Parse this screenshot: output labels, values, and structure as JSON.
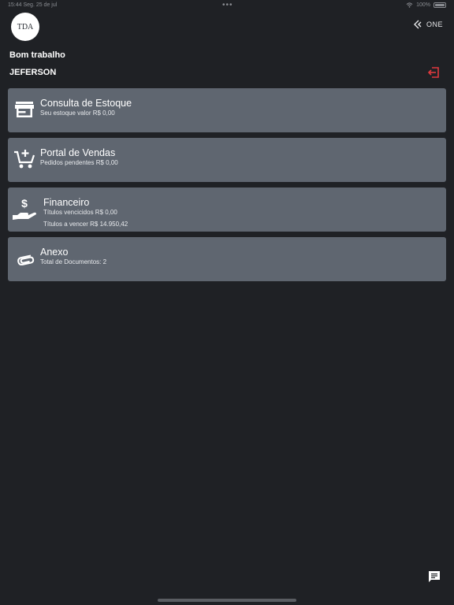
{
  "status_bar": {
    "time": "15:44",
    "date": "Seg. 25 de jul",
    "battery": "100%"
  },
  "header": {
    "logo_text": "TDA",
    "brand_text": "ONE",
    "greeting": "Bom trabalho",
    "username": "JEFERSON"
  },
  "cards": [
    {
      "title": "Consulta de Estoque",
      "lines": [
        "Seu estoque valor R$ 0,00"
      ],
      "icon": "store-icon"
    },
    {
      "title": "Portal de Vendas",
      "lines": [
        "Pedidos  pendentes R$ 0,00"
      ],
      "icon": "cart-add-icon"
    },
    {
      "title": "Financeiro",
      "lines": [
        "Títulos vencicidos R$ 0,00",
        "Títulos a vencer R$ 14.950,42"
      ],
      "icon": "money-hand-icon"
    },
    {
      "title": "Anexo",
      "lines": [
        "Total de Documentos: 2"
      ],
      "icon": "paperclip-icon"
    }
  ],
  "colors": {
    "background": "#1f2125",
    "card": "#5f6670",
    "logout_accent": "#e0393e"
  }
}
